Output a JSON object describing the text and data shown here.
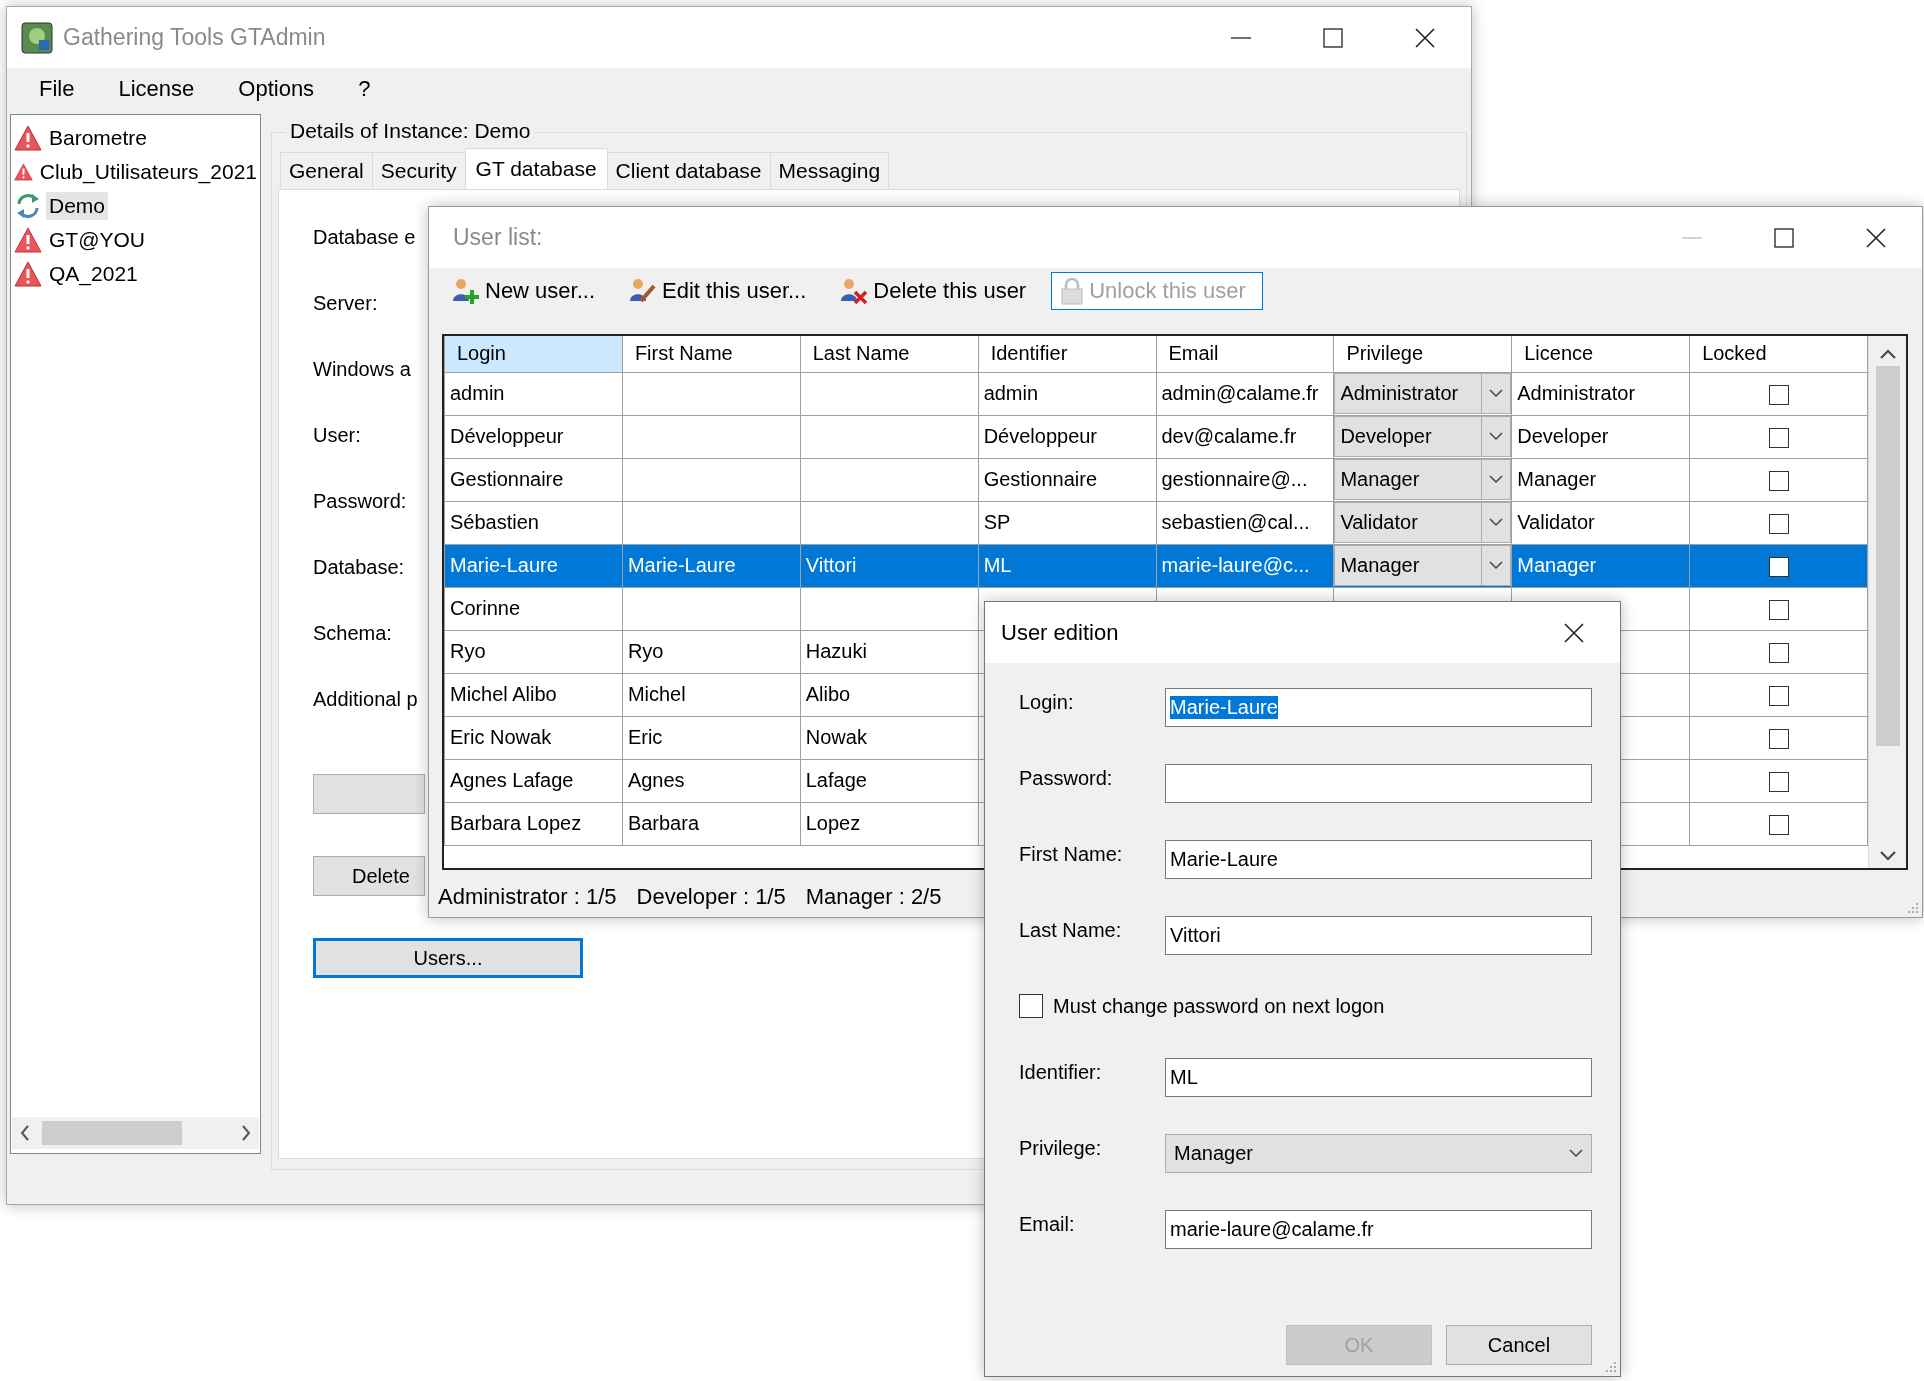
{
  "main_window": {
    "title": "Gathering Tools GTAdmin",
    "menu": [
      "File",
      "License",
      "Options",
      "?"
    ],
    "instances": [
      {
        "name": "Barometre",
        "kind": "warning",
        "selected": false
      },
      {
        "name": "Club_Utilisateurs_2021",
        "kind": "warning",
        "selected": false
      },
      {
        "name": "Demo",
        "kind": "sync",
        "selected": true
      },
      {
        "name": "GT@YOU",
        "kind": "warning",
        "selected": false
      },
      {
        "name": "QA_2021",
        "kind": "warning",
        "selected": false
      }
    ],
    "details_title": "Details of Instance: Demo",
    "tabs": [
      {
        "label": "General",
        "selected": false
      },
      {
        "label": "Security",
        "selected": false
      },
      {
        "label": "GT database",
        "selected": true
      },
      {
        "label": "Client database",
        "selected": false
      },
      {
        "label": "Messaging",
        "selected": false
      }
    ],
    "field_labels": [
      "Database e",
      "Server:",
      "Windows a",
      "User:",
      "Password:",
      "Database:",
      "Schema:",
      "Additional p"
    ],
    "buttons": [
      {
        "focused": false
      },
      {
        "label": "Delete",
        "focused": false
      },
      {
        "label": "Users...",
        "focused": true
      }
    ]
  },
  "user_list": {
    "title": "User list:",
    "toolbar": [
      {
        "label": "New user...",
        "disabled": false
      },
      {
        "label": "Edit this user...",
        "disabled": false
      },
      {
        "label": "Delete this user",
        "disabled": false
      },
      {
        "label": "Unlock this user",
        "disabled": true
      }
    ],
    "columns": [
      {
        "label": "Login",
        "highlighted": true
      },
      {
        "label": "First Name",
        "highlighted": false
      },
      {
        "label": "Last Name",
        "highlighted": false
      },
      {
        "label": "Identifier",
        "highlighted": false
      },
      {
        "label": "Email",
        "highlighted": false
      },
      {
        "label": "Privilege",
        "highlighted": false
      },
      {
        "label": "Licence",
        "highlighted": false
      },
      {
        "label": "Locked",
        "highlighted": false
      }
    ],
    "rows": [
      {
        "login": "admin",
        "identifier": "admin",
        "email": "admin@calame.fr",
        "privilege": "Administrator",
        "licence": "Administrator",
        "locked": false,
        "selected": false
      },
      {
        "login": "Développeur",
        "identifier": "Développeur",
        "email": "dev@calame.fr",
        "privilege": "Developer",
        "licence": "Developer",
        "locked": false,
        "selected": false
      },
      {
        "login": "Gestionnaire",
        "identifier": "Gestionnaire",
        "email": "gestionnaire@...",
        "privilege": "Manager",
        "licence": "Manager",
        "locked": false,
        "selected": false
      },
      {
        "login": "Sébastien",
        "identifier": "SP",
        "email": "sebastien@cal...",
        "privilege": "Validator",
        "licence": "Validator",
        "locked": false,
        "selected": false
      },
      {
        "login": "Marie-Laure",
        "first_name": "Marie-Laure",
        "last_name": "Vittori",
        "identifier": "ML",
        "email": "marie-laure@c...",
        "privilege": "Manager",
        "licence": "Manager",
        "locked": false,
        "selected": true
      },
      {
        "login": "Corinne",
        "locked": false,
        "selected": false
      },
      {
        "login": "Ryo",
        "first_name": "Ryo",
        "last_name": "Hazuki",
        "locked": false,
        "selected": false
      },
      {
        "login": "Michel Alibo",
        "first_name": "Michel",
        "last_name": "Alibo",
        "locked": false,
        "selected": false
      },
      {
        "login": "Eric Nowak",
        "first_name": "Eric",
        "last_name": "Nowak",
        "locked": false,
        "selected": false
      },
      {
        "login": "Agnes Lafage",
        "first_name": "Agnes",
        "last_name": "Lafage",
        "locked": false,
        "selected": false
      },
      {
        "login": "Barbara Lopez",
        "first_name": "Barbara",
        "last_name": "Lopez",
        "locked": false,
        "selected": false
      }
    ],
    "status": [
      "Administrator : 1/5",
      "Developer : 1/5",
      "Manager : 2/5"
    ]
  },
  "user_edition": {
    "title": "User edition",
    "fields": [
      {
        "kind": "text",
        "label": "Login:",
        "value": "Marie-Laure",
        "highlighted": true
      },
      {
        "kind": "text",
        "label": "Password:"
      },
      {
        "kind": "text",
        "label": "First Name:",
        "value": "Marie-Laure"
      },
      {
        "kind": "text",
        "label": "Last Name:",
        "value": "Vittori"
      },
      {
        "kind": "checkbox",
        "label": "Must change password on next logon",
        "checked": false
      },
      {
        "kind": "text",
        "label": "Identifier:",
        "value": "ML"
      },
      {
        "kind": "select",
        "label": "Privilege:",
        "value": "Manager"
      },
      {
        "kind": "text",
        "label": "Email:",
        "value": "marie-laure@calame.fr"
      }
    ],
    "buttons": [
      {
        "label": "OK",
        "disabled": true
      },
      {
        "label": "Cancel",
        "disabled": false
      }
    ]
  }
}
